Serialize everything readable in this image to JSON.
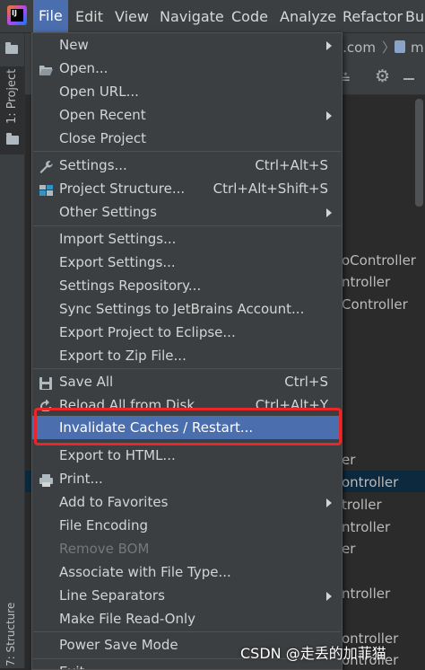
{
  "menubar": {
    "logo_text": "IJ",
    "items": [
      "File",
      "Edit",
      "View",
      "Navigate",
      "Code",
      "Analyze",
      "Refactor",
      "Bu"
    ]
  },
  "left_stripe": {
    "project_tab": "1: Project",
    "structure_tab": "7: Structure"
  },
  "background": {
    "breadcrumb_fragment": "l.com",
    "breadcrumb_fragment2": "m",
    "tree_fragments": [
      "oController",
      "ntroller",
      "Controller",
      "er",
      "ontroller",
      "troller",
      "ntroller",
      "er",
      "ntroller",
      "ontroller",
      "ontroller"
    ]
  },
  "file_menu": {
    "items": [
      {
        "label": "New",
        "submenu": true
      },
      {
        "label": "Open...",
        "icon": "folder-open-icon"
      },
      {
        "label": "Open URL..."
      },
      {
        "label": "Open Recent",
        "submenu": true
      },
      {
        "label": "Close Project"
      },
      {
        "label": "Settings...",
        "shortcut": "Ctrl+Alt+S",
        "icon": "wrench-icon"
      },
      {
        "label": "Project Structure...",
        "shortcut": "Ctrl+Alt+Shift+S",
        "icon": "project-structure-icon"
      },
      {
        "label": "Other Settings",
        "submenu": true
      },
      {
        "label": "Import Settings..."
      },
      {
        "label": "Export Settings..."
      },
      {
        "label": "Settings Repository..."
      },
      {
        "label": "Sync Settings to JetBrains Account..."
      },
      {
        "label": "Export Project to Eclipse..."
      },
      {
        "label": "Export to Zip File..."
      },
      {
        "label": "Save All",
        "shortcut": "Ctrl+S",
        "icon": "save-icon"
      },
      {
        "label": "Reload All from Disk",
        "shortcut": "Ctrl+Alt+Y",
        "icon": "reload-icon"
      },
      {
        "label": "Invalidate Caches / Restart..."
      },
      {
        "label": "Export to HTML..."
      },
      {
        "label": "Print...",
        "icon": "print-icon"
      },
      {
        "label": "Add to Favorites",
        "submenu": true
      },
      {
        "label": "File Encoding"
      },
      {
        "label": "Remove BOM"
      },
      {
        "label": "Associate with File Type..."
      },
      {
        "label": "Line Separators",
        "submenu": true
      },
      {
        "label": "Make File Read-Only"
      },
      {
        "label": "Power Save Mode"
      },
      {
        "label": "Exit"
      }
    ]
  },
  "watermark": "CSDN @走丢的加菲猫"
}
